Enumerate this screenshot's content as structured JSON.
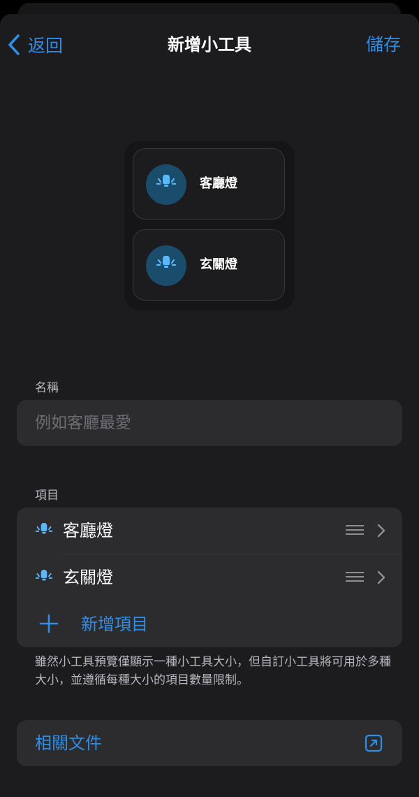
{
  "nav": {
    "back_label": "返回",
    "title": "新增小工具",
    "save_label": "儲存"
  },
  "preview": {
    "tiles": [
      {
        "label": "客廳燈"
      },
      {
        "label": "玄關燈"
      }
    ]
  },
  "name_section": {
    "header": "名稱",
    "placeholder": "例如客廳最愛",
    "value": ""
  },
  "items_section": {
    "header": "項目",
    "items": [
      {
        "label": "客廳燈",
        "icon": "light-bulb-icon"
      },
      {
        "label": "玄關燈",
        "icon": "light-bulb-icon"
      }
    ],
    "add_label": "新增項目",
    "footnote": "雖然小工具預覽僅顯示一種小工具大小，但自訂小工具將可用於多種大小，並遵循每種大小的項目數量限制。"
  },
  "docs": {
    "label": "相關文件",
    "icon": "external-link-icon"
  },
  "colors": {
    "accent": "#2f8ee6",
    "background": "#1c1c1e",
    "card": "#2c2c2e",
    "icon_circle": "#194d6b"
  }
}
